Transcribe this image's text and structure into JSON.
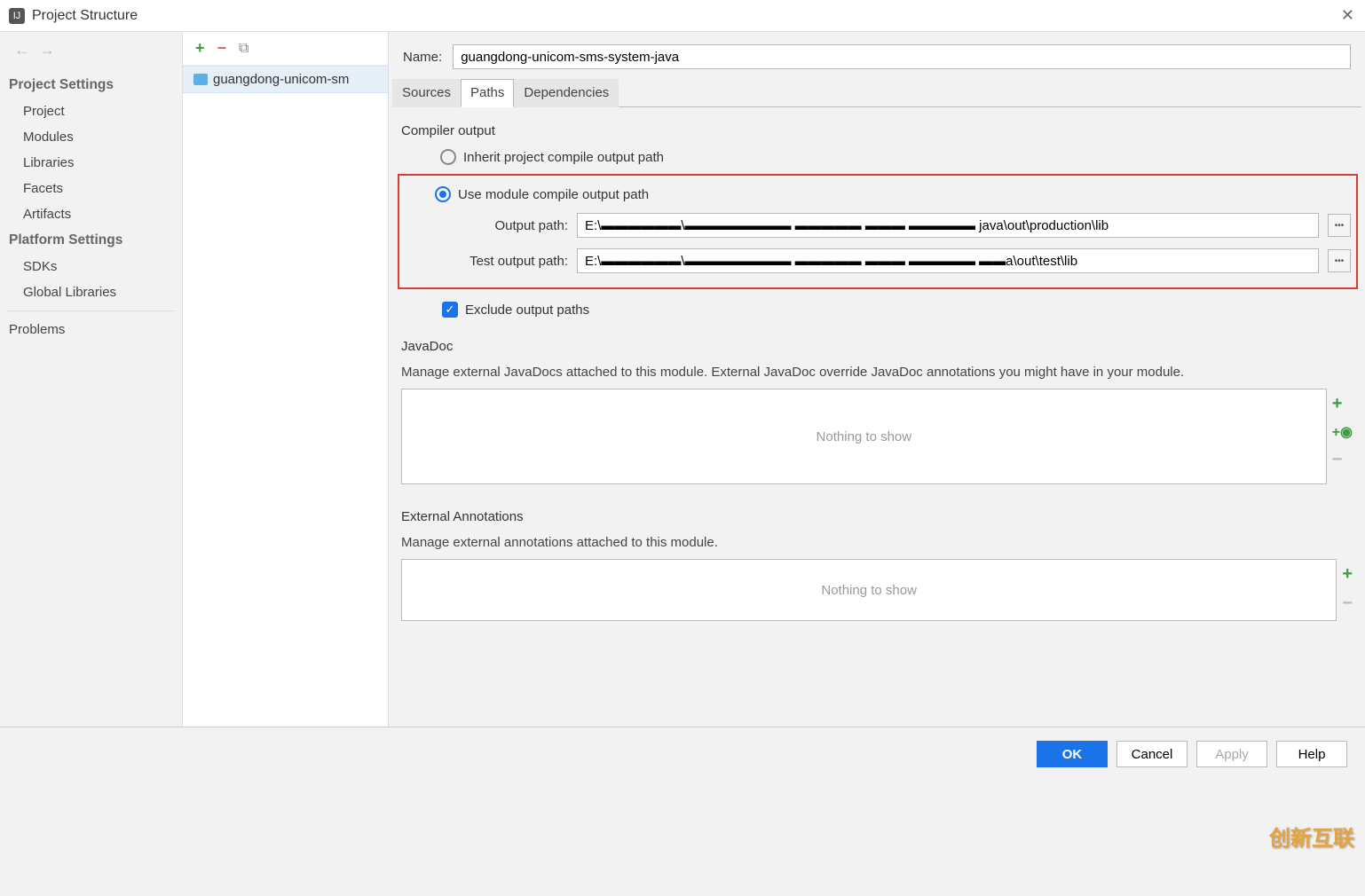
{
  "window": {
    "title": "Project Structure"
  },
  "sidebar": {
    "section1": "Project Settings",
    "items1": [
      "Project",
      "Modules",
      "Libraries",
      "Facets",
      "Artifacts"
    ],
    "section2": "Platform Settings",
    "items2": [
      "SDKs",
      "Global Libraries"
    ],
    "problems": "Problems"
  },
  "tree": {
    "module": "guangdong-unicom-sm"
  },
  "details": {
    "name_label": "Name:",
    "name_value": "guangdong-unicom-sms-system-java",
    "tabs": [
      "Sources",
      "Paths",
      "Dependencies"
    ],
    "active_tab": 1,
    "compiler_output": "Compiler output",
    "inherit_label": "Inherit project compile output path",
    "use_module_label": "Use module compile output path",
    "output_path_label": "Output path:",
    "output_path_value": "E:\\▬▬▬▬▬▬\\▬▬▬▬▬▬▬▬ ▬▬▬▬▬ ▬▬▬ ▬▬▬▬▬ java\\out\\production\\lib",
    "test_output_path_label": "Test output path:",
    "test_output_path_value": "E:\\▬▬▬▬▬▬\\▬▬▬▬▬▬▬▬ ▬▬▬▬▬ ▬▬▬ ▬▬▬▬▬ ▬▬a\\out\\test\\lib",
    "exclude_label": "Exclude output paths",
    "javadoc_title": "JavaDoc",
    "javadoc_desc": "Manage external JavaDocs attached to this module. External JavaDoc override JavaDoc annotations you might have in your module.",
    "nothing": "Nothing to show",
    "ext_ann_title": "External Annotations",
    "ext_ann_desc": "Manage external annotations attached to this module."
  },
  "footer": {
    "ok": "OK",
    "cancel": "Cancel",
    "apply": "Apply",
    "help": "Help"
  },
  "watermark": "创新互联"
}
